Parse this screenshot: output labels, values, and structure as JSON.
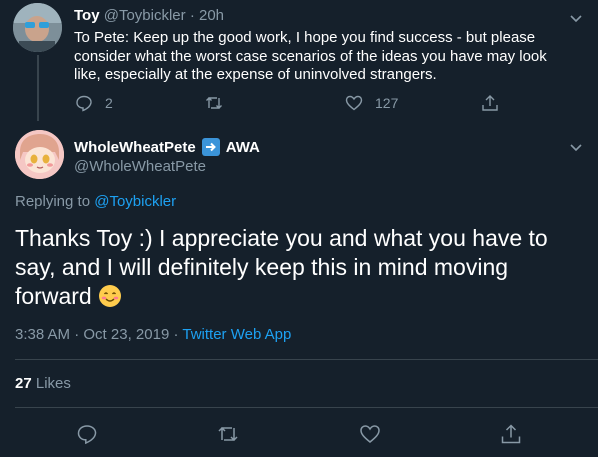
{
  "reply_tweet": {
    "name": "Toy",
    "handle": "@Toybickler",
    "separator": "·",
    "age": "20h",
    "text": "To Pete: Keep up the good work, I hope you find success - but please consider what the worst case scenarios of the ideas you have may look like, especially at the expense of uninvolved strangers.",
    "replies": "2",
    "likes": "127"
  },
  "main_tweet": {
    "name": "WholeWheatPete",
    "badge": "AWA",
    "handle": "@WholeWheatPete",
    "replying_prefix": "Replying to",
    "replying_to": "@Toybickler",
    "text": "Thanks Toy :) I appreciate you and what you have to say, and I will definitely keep this in mind moving forward",
    "time": "3:38 AM",
    "sep1": "·",
    "date": "Oct 23, 2019",
    "sep2": "·",
    "app": "Twitter Web App",
    "likes_count": "27",
    "likes_label": "Likes"
  },
  "colors": {
    "background": "#15202b",
    "muted": "#8899a6",
    "accent": "#1da1f2",
    "divider": "#38444d"
  }
}
